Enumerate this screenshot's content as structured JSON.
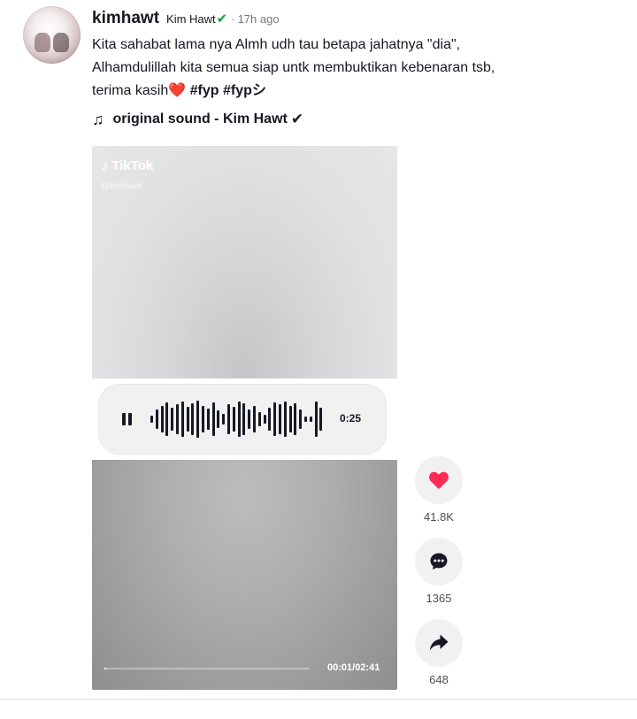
{
  "post": {
    "username": "kimhawt",
    "nickname": "Kim Hawt",
    "verified_mark": "✔",
    "separator": "·",
    "time": "17h ago",
    "caption_line1": "Kita sahabat lama nya Almh udh tau betapa jahatnya \"dia\",",
    "caption_line2": "Alhamdulillah kita semua siap untk membuktikan kebenaran tsb,",
    "caption_line3": "terima kasih",
    "caption_emoji": "❤️",
    "hashtag1": "#fyp",
    "hashtag2": "#fypシ",
    "sound": "original sound - Kim Hawt",
    "sound_check": "✔"
  },
  "video": {
    "watermark": "TikTok",
    "watermark_handle": "@kimhawt",
    "audio_time": "0:25",
    "progress_label": "00:01/02:41",
    "progress_fraction": 0.006
  },
  "actions": {
    "likes": "41.8K",
    "comments": "1365",
    "shares": "648"
  },
  "colors": {
    "like": "#fe2c55",
    "verified": "#1a9e3a",
    "text": "#161823"
  },
  "icons": {
    "music": "music-note-icon",
    "like": "heart-icon",
    "comment": "comment-icon",
    "share": "share-icon",
    "pause": "pause-icon"
  }
}
